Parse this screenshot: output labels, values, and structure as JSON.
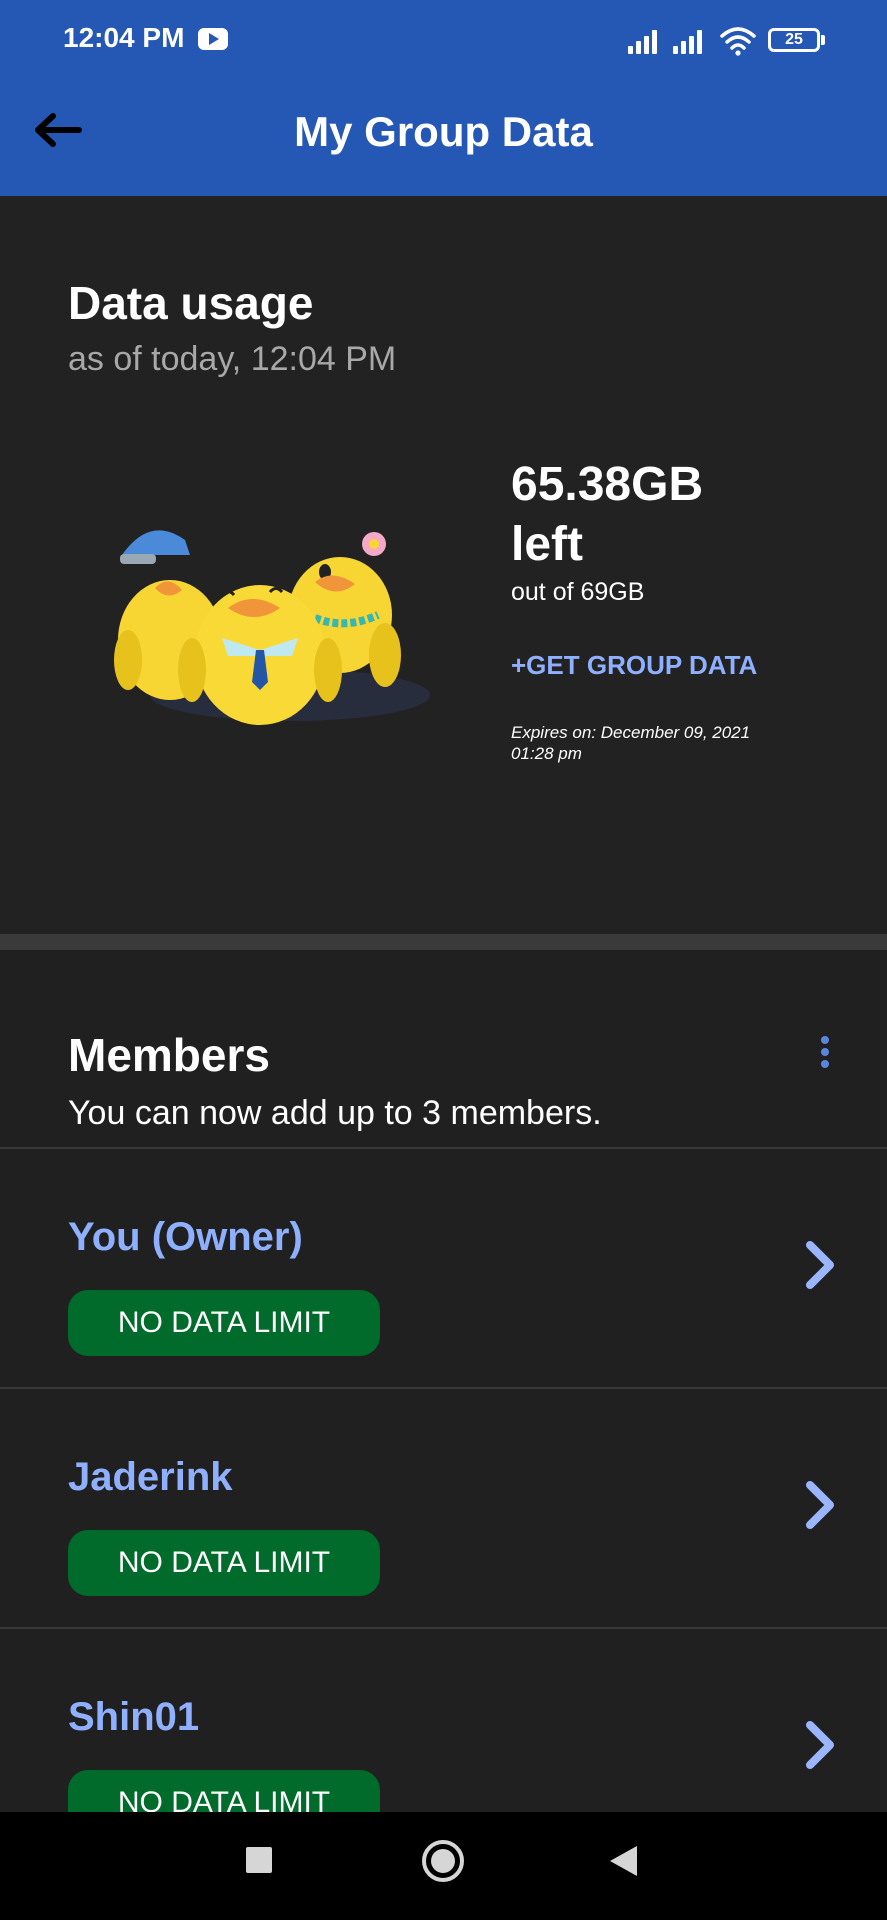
{
  "status_bar": {
    "time": "12:04 PM",
    "battery": "25"
  },
  "app_bar": {
    "title": "My Group Data"
  },
  "usage": {
    "heading": "Data usage",
    "as_of": "as of today, 12:04 PM",
    "left_amount": "65.38GB",
    "left_word": "left",
    "out_of": "out of 69GB",
    "get_data_label": "+GET GROUP DATA",
    "expires_line1": "Expires on: December 09, 2021",
    "expires_line2": "01:28 pm"
  },
  "members": {
    "heading": "Members",
    "subtitle": "You can now add up to 3 members.",
    "list": [
      {
        "name": "You (Owner)",
        "limit": "NO DATA LIMIT"
      },
      {
        "name": "Jaderink",
        "limit": "NO DATA LIMIT"
      },
      {
        "name": "Shin01",
        "limit": "NO DATA LIMIT"
      }
    ]
  },
  "colors": {
    "app_bar": "#2557b5",
    "accent_link": "#8fb0ff",
    "badge_green": "#006b2b",
    "background": "#202020"
  },
  "icons": [
    "youtube-icon",
    "signal-icon",
    "wifi-icon",
    "battery-icon",
    "back-arrow-icon",
    "kebab-menu-icon",
    "chevron-right-icon",
    "nav-recents-icon",
    "nav-home-icon",
    "nav-back-icon"
  ]
}
